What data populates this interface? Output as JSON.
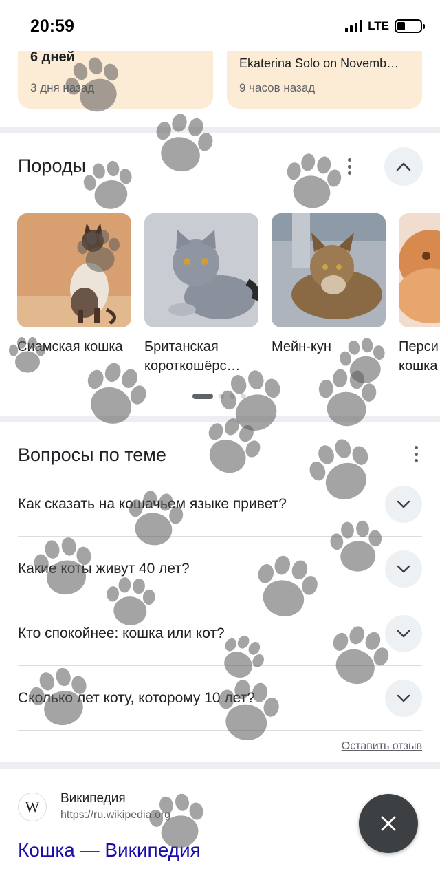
{
  "status_bar": {
    "time": "20:59",
    "network": "LTE",
    "battery_level": 0.35
  },
  "top_cards": [
    {
      "title": "6 дней",
      "time": "3 дня назад"
    },
    {
      "title": "Ekaterina Solo on Novemb…",
      "time": "9 часов назад"
    }
  ],
  "breeds": {
    "title": "Породы",
    "items": [
      {
        "name": "Сиамская кошка"
      },
      {
        "name": "Британская короткошёрс…"
      },
      {
        "name": "Мейн-кун"
      },
      {
        "name": "Перси кошка"
      }
    ]
  },
  "questions": {
    "title": "Вопросы по теме",
    "items": [
      "Как сказать на кошачьем языке привет?",
      "Какие коты живут 40 лет?",
      "Кто спокойнее: кошка или кот?",
      "Сколько лет коту, которому 10 лет?"
    ],
    "feedback": "Оставить отзыв"
  },
  "result": {
    "favicon_letter": "W",
    "site": "Википедия",
    "url": "https://ru.wikipedia.org",
    "title": "Кошка — Википедия"
  },
  "colors": {
    "card_bg": "#fdecd5",
    "link": "#1a0dab",
    "fab": "#3c4043"
  }
}
